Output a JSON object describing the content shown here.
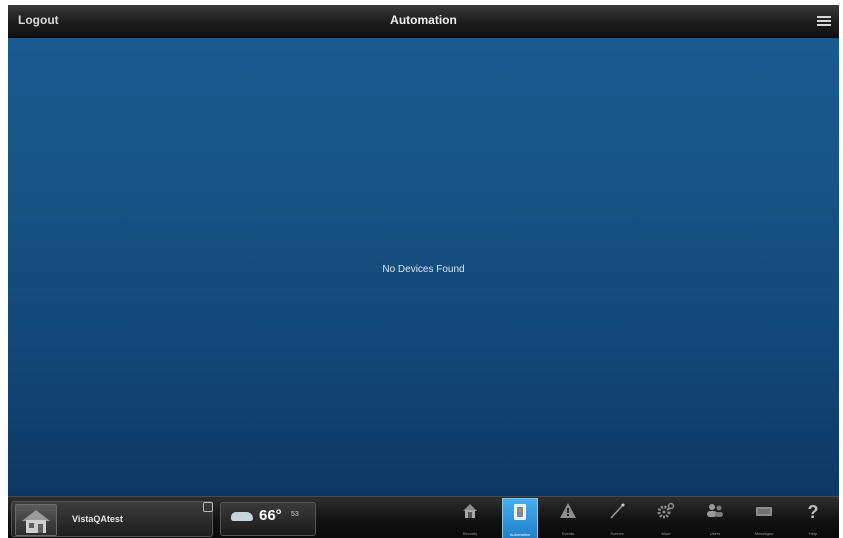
{
  "header": {
    "logout_label": "Logout",
    "title": "Automation"
  },
  "main": {
    "empty_message": "No Devices Found"
  },
  "footer": {
    "account_name": "VistaQAtest",
    "weather": {
      "temperature": "66°",
      "high_low": "53"
    },
    "tabs": [
      {
        "label": "Security",
        "icon": "security-icon",
        "active": false
      },
      {
        "label": "Automation",
        "icon": "automation-icon",
        "active": true
      },
      {
        "label": "Events",
        "icon": "events-icon",
        "active": false
      },
      {
        "label": "Scenes",
        "icon": "scenes-icon",
        "active": false
      },
      {
        "label": "More",
        "icon": "gear-icon",
        "active": false
      },
      {
        "label": "Users",
        "icon": "users-icon",
        "active": false
      },
      {
        "label": "Messages",
        "icon": "messages-icon",
        "active": false
      },
      {
        "label": "Help",
        "icon": "help-icon",
        "active": false
      }
    ]
  },
  "colors": {
    "accent_active_tab": "#2a8fd6",
    "content_top": "#1a5a8f",
    "content_bottom": "#0e3864"
  }
}
